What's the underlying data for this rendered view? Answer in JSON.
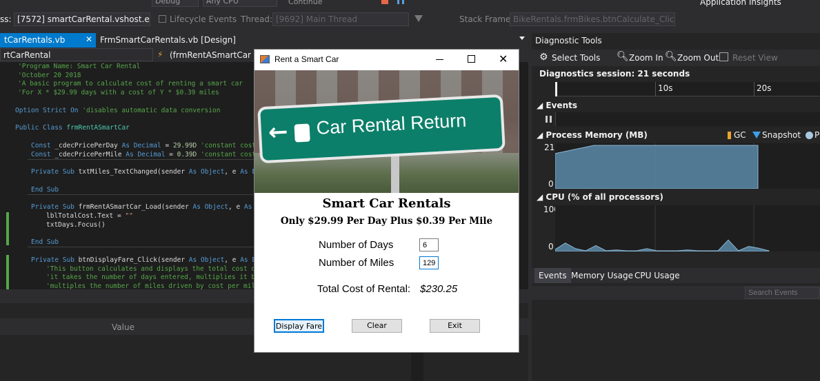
{
  "toolbar": {
    "debug": "Debug",
    "cpu": "Any CPU",
    "continue": "Continue",
    "insights": "Application Insights"
  },
  "debugbar": {
    "process_label": "ss:",
    "process": "[7572] smartCarRental.vshost.exe",
    "lifecycle": "Lifecycle Events",
    "thread_label": "Thread:",
    "thread": "[9692] Main Thread",
    "stack_label": "Stack Frame:",
    "stack": "BikeRentals.frmBikes.btnCalculate_Click"
  },
  "tabs": {
    "tab1": "tCarRentals.vb",
    "tab2": "FrmSmartCarRentals.vb [Design]"
  },
  "nav": {
    "left": "rtCarRental",
    "right": "(frmRentASmartCar Ev"
  },
  "code": [
    [
      "cm",
      "'Program Name: Smart Car Rental"
    ],
    [
      "cm",
      "'October 20 2018"
    ],
    [
      "cm",
      "'A basic program to calculate cost of renting a smart car"
    ],
    [
      "cm",
      "'For X * $29.99 days with a cost of Y * $0.39 miles"
    ]
  ],
  "code2": {
    "opt_kw": "Option Strict On",
    "opt_cm": "'disables automatic data conversion",
    "cls_kw": "Public Class",
    "cls_ty": "frmRentASmartCar",
    "c1a": "Const _cdecPricePerDay ",
    "c1b": "As ",
    "c1c": "Decimal",
    "c1d": " = ",
    "c1e": "29.99D",
    "c1f": " 'constant cost of",
    "c2a": "Const _cdecPricePerMile ",
    "c2b": "As ",
    "c2c": "Decimal",
    "c2d": " = ",
    "c2e": "0.39D",
    "c2f": " 'constant cost of",
    "s1a": "Private Sub ",
    "s1b": "txtMiles_TextChanged(sender ",
    "s1c": "As ",
    "s1d": "Object",
    ", e ": "",
    "s1e": ", e ",
    "s1f": "As Even",
    "end1": "End Sub",
    "s2a": "Private Sub ",
    "s2b": "frmRentASmartCar_Load(sender ",
    "s2c": "As ",
    "s2d": "Object",
    "s2e": ", e ",
    "s2f": "As Eve",
    "l1a": "lblTotalCost.Text = ",
    "l1b": "\"\"",
    "l2": "txtDays.Focus()",
    "end2": "End Sub",
    "s3a": "Private Sub ",
    "s3b": "btnDisplayFare_Click(sender ",
    "s3c": "As ",
    "s3d": "Object",
    "s3e": ", e ",
    "s3f": "As Even",
    "c3": "'This button calculates and displays the total cost of r",
    "c4": "'it takes the number of days entered, multiplies it by t",
    "c5": "'multiples the number of miles driven by cost per miles"
  },
  "bottom": {
    "value_header": "Value"
  },
  "diag": {
    "title": "Diagnostic Tools",
    "select_tools": "Select Tools",
    "zoom_in": "Zoom In",
    "zoom_out": "Zoom Out",
    "reset_view": "Reset View",
    "session": "Diagnostics session: 21 seconds",
    "t10": "10s",
    "t20": "20s",
    "events": "Events",
    "memory": "Process Memory (MB)",
    "gc": "GC",
    "snapshot": "Snapshot",
    "pr": "Pr",
    "mem_max": "21",
    "mem_min": "0",
    "cpu": "CPU (% of all processors)",
    "cpu_max": "100",
    "cpu_min": "0",
    "tab_events": "Events",
    "tab_memory": "Memory Usage",
    "tab_cpu": "CPU Usage",
    "search": "Search Events"
  },
  "dialog": {
    "title": "Rent a Smart Car",
    "sign": "Car Rental Return",
    "heading": "Smart Car Rentals",
    "subheading": "Only $29.99 Per Day Plus $0.39 Per Mile",
    "days_label": "Number of Days",
    "days_value": "6",
    "miles_label": "Number of Miles",
    "miles_value": "129",
    "total_label": "Total Cost of Rental:",
    "total_value": "$230.25",
    "display_btn": "Display Fare",
    "clear_btn": "Clear",
    "exit_btn": "Exit"
  },
  "chart_data": [
    {
      "type": "area",
      "title": "Process Memory (MB)",
      "ylim": [
        0,
        21
      ],
      "x": [
        0,
        1,
        2,
        3,
        4,
        5,
        6,
        7,
        8,
        9,
        10,
        11,
        12,
        13,
        14,
        15,
        16,
        17,
        18,
        19,
        20,
        21
      ],
      "series": [
        {
          "values": [
            17,
            18,
            19,
            20,
            21,
            21,
            21,
            21,
            21,
            21,
            21,
            21,
            21,
            21,
            21,
            21,
            21,
            21,
            21,
            21,
            21,
            21
          ]
        }
      ]
    },
    {
      "type": "area",
      "title": "CPU (% of all processors)",
      "ylim": [
        0,
        100
      ],
      "x": [
        0,
        1,
        2,
        3,
        4,
        5,
        6,
        7,
        8,
        9,
        10,
        11,
        12,
        13,
        14,
        15,
        16,
        17,
        18,
        19,
        20,
        21
      ],
      "series": [
        {
          "values": [
            3,
            18,
            5,
            0,
            12,
            0,
            2,
            0,
            0,
            5,
            0,
            0,
            0,
            2,
            0,
            0,
            0,
            25,
            0,
            10,
            6,
            0
          ]
        }
      ]
    }
  ],
  "colors": {
    "chart_fill": "#5c8aa8",
    "chart_line": "#8ab7d4",
    "accent": "#007acc"
  }
}
